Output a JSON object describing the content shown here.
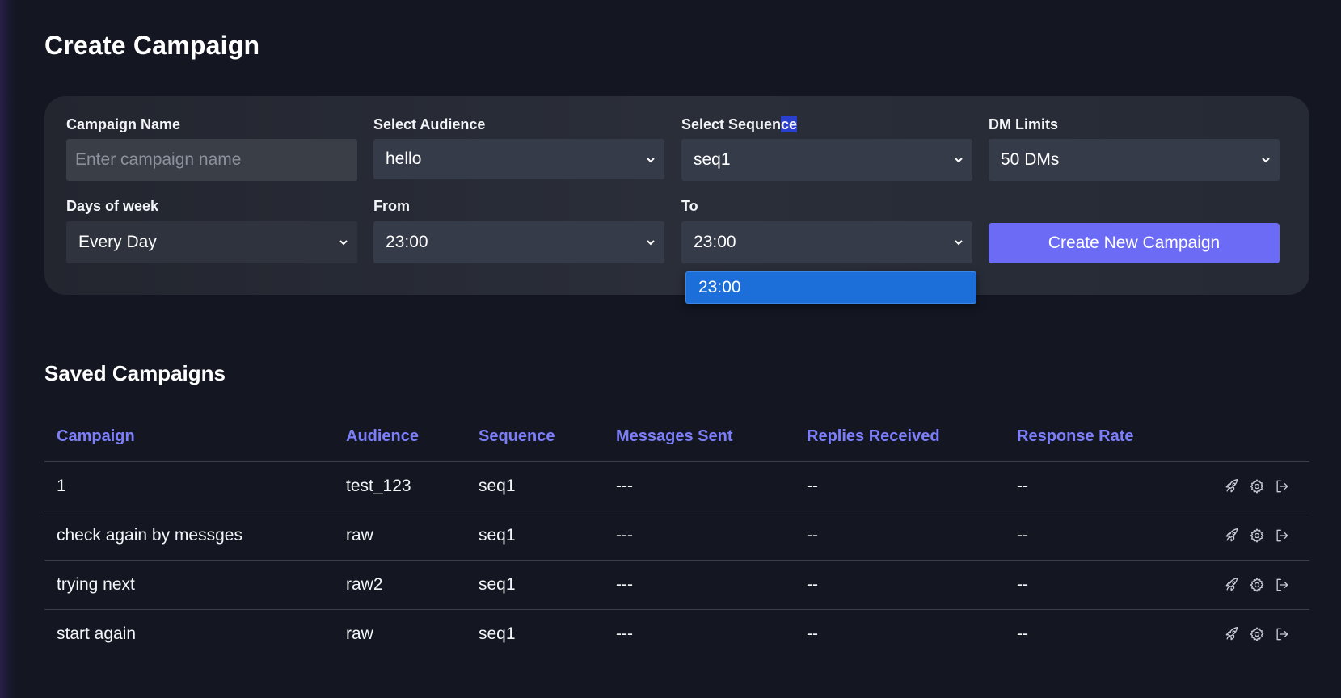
{
  "page": {
    "title": "Create Campaign"
  },
  "form": {
    "campaign_name": {
      "label": "Campaign Name",
      "placeholder": "Enter campaign name",
      "value": ""
    },
    "audience": {
      "label": "Select Audience",
      "value": "hello"
    },
    "sequence": {
      "label_main": "Select Sequen",
      "label_highlight": "ce",
      "value": "seq1"
    },
    "dm_limits": {
      "label": "DM Limits",
      "value": "50 DMs"
    },
    "days": {
      "label": "Days of week",
      "value": "Every Day"
    },
    "from": {
      "label": "From",
      "value": "23:00"
    },
    "to": {
      "label": "To",
      "value": "23:00",
      "open_option": "23:00"
    },
    "create_button": "Create New Campaign"
  },
  "saved": {
    "title": "Saved Campaigns",
    "columns": [
      "Campaign",
      "Audience",
      "Sequence",
      "Messages Sent",
      "Replies Received",
      "Response Rate"
    ],
    "rows": [
      {
        "campaign": "1",
        "audience": "test_123",
        "sequence": "seq1",
        "sent": "---",
        "replies": "--",
        "rate": "--"
      },
      {
        "campaign": "check again by messges",
        "audience": "raw",
        "sequence": "seq1",
        "sent": "---",
        "replies": "--",
        "rate": "--"
      },
      {
        "campaign": "trying next",
        "audience": "raw2",
        "sequence": "seq1",
        "sent": "---",
        "replies": "--",
        "rate": "--"
      },
      {
        "campaign": "start again",
        "audience": "raw",
        "sequence": "seq1",
        "sent": "---",
        "replies": "--",
        "rate": "--"
      }
    ],
    "row_actions": [
      "rocket-icon",
      "gear-icon",
      "logout-icon"
    ]
  },
  "colors": {
    "accent": "#6c6bf5",
    "header_text": "#7b7ef8",
    "background": "#141722",
    "dropdown_selected": "#1c6fd8"
  }
}
